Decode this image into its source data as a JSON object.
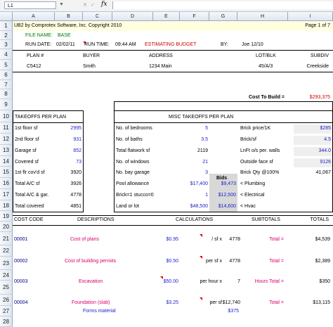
{
  "formula_bar": {
    "cell_ref": "L1",
    "fx": "fx"
  },
  "columns": [
    "A",
    "B",
    "C",
    "D",
    "E",
    "F",
    "G",
    "H",
    "I"
  ],
  "rows": [
    "1",
    "2",
    "3",
    "4",
    "5",
    "6",
    "7",
    "8",
    "9",
    "10",
    "11",
    "12",
    "13",
    "14",
    "15",
    "16",
    "17",
    "18",
    "19",
    "20",
    "21",
    "22",
    "23",
    "24",
    "25",
    "26",
    "27",
    "28",
    "29"
  ],
  "header": {
    "title": "UB2 by Comprotex Software, Inc. Copyright 2010",
    "page": "Page 1 of 7",
    "file_name_label": "FILE NAME:",
    "file_name": "BASE",
    "run_date_label": "RUN DATE:",
    "run_date": "02/02/11",
    "run_time_label": "RUN TIME:",
    "run_time": "09:44 AM",
    "estimating": "ESTIMATING BUDGET",
    "by_label": "BY:",
    "by": "Joe 12/10"
  },
  "plan": {
    "plan_label": "PLAN #",
    "buyer_label": "BUYER",
    "address_label": "ADDRESS",
    "lot_label": "LOT/BLK",
    "subdiv_label": "SUBDIV",
    "plan": "C5412",
    "buyer": "Smith",
    "address": "1234 Main",
    "lot": "45/A/3",
    "subdiv": "Creekside"
  },
  "cost_to_build": {
    "label": "Cost To Build =",
    "value": "$293,375"
  },
  "takeoffs": {
    "title": "TAKEOFFS PER PLAN",
    "items": [
      {
        "label": "1st floor sf",
        "value": "2995"
      },
      {
        "label": "2nd floor sf",
        "value": "931"
      },
      {
        "label": "Garage sf",
        "value": "852"
      },
      {
        "label": "Covered sf",
        "value": "73"
      },
      {
        "label": "1st flr cov'd sf",
        "value": "3920"
      },
      {
        "label": "Total A/C sf",
        "value": "3926"
      },
      {
        "label": "Total A/C & gar.",
        "value": "4778"
      },
      {
        "label": "Total covered",
        "value": "4851"
      }
    ]
  },
  "misc": {
    "title": "MISC TAKEOFFS PER PLAN",
    "bids_label": "Bids",
    "left": [
      {
        "label": "No. of bedrooms",
        "value": "5"
      },
      {
        "label": "No. of baths",
        "value": "3.5"
      },
      {
        "label": "Total flatwork sf",
        "value": "2119"
      },
      {
        "label": "No. of windows",
        "value": "21"
      },
      {
        "label": "No. bay garage",
        "value": "3"
      },
      {
        "label": "Pool allowance",
        "value": "$17,400"
      },
      {
        "label": "Brick=1 stucco=0",
        "value": "1"
      },
      {
        "label": "Land or lot",
        "value": "$48,500"
      }
    ],
    "bids": [
      "$9,473",
      "$12,500",
      "$14,600"
    ],
    "right": [
      {
        "label": "Brick price/1K",
        "value": "$285"
      },
      {
        "label": "Brick/sf",
        "value": "4.5"
      },
      {
        "label": "LnFt o/s per. walls",
        "value": "344.0"
      },
      {
        "label": "Outside face sf",
        "value": "9126"
      },
      {
        "label": "Brick Qty @100%",
        "value": "41,067"
      },
      {
        "label": "< Plumbing",
        "value": ""
      },
      {
        "label": "< Electrical",
        "value": ""
      },
      {
        "label": "< Hvac",
        "value": ""
      }
    ]
  },
  "cost_header": {
    "code": "COST CODE",
    "desc": "DESCRIPTIONS",
    "calc": "CALCULATIONS",
    "sub": "SUBTOTALS",
    "totals": "TOTALS"
  },
  "costs": [
    {
      "code": "00001",
      "desc": "Cost of plans",
      "rate": "$0.95",
      "unit": "/ sf x",
      "qty": "4778",
      "eq": "Total =",
      "total": "$4,539"
    },
    {
      "code": "00002",
      "desc": "Cost of building permits",
      "rate": "$0.50",
      "unit": "per sf x",
      "qty": "4778",
      "eq": "Total =",
      "total": "$2,389"
    },
    {
      "code": "00003",
      "desc": "Excavation",
      "rate": "$50.00",
      "unit": "per hour x",
      "qty": "7",
      "eq": "Hours Total =",
      "total": "$350"
    },
    {
      "code": "00004",
      "desc": "Foundation (slab)",
      "rate": "$3.25",
      "unit": "per sf",
      "qty": "$12,740",
      "eq": "Total =",
      "total": "$13,115"
    }
  ],
  "forms": {
    "label": "Forms material",
    "value": "$375"
  }
}
